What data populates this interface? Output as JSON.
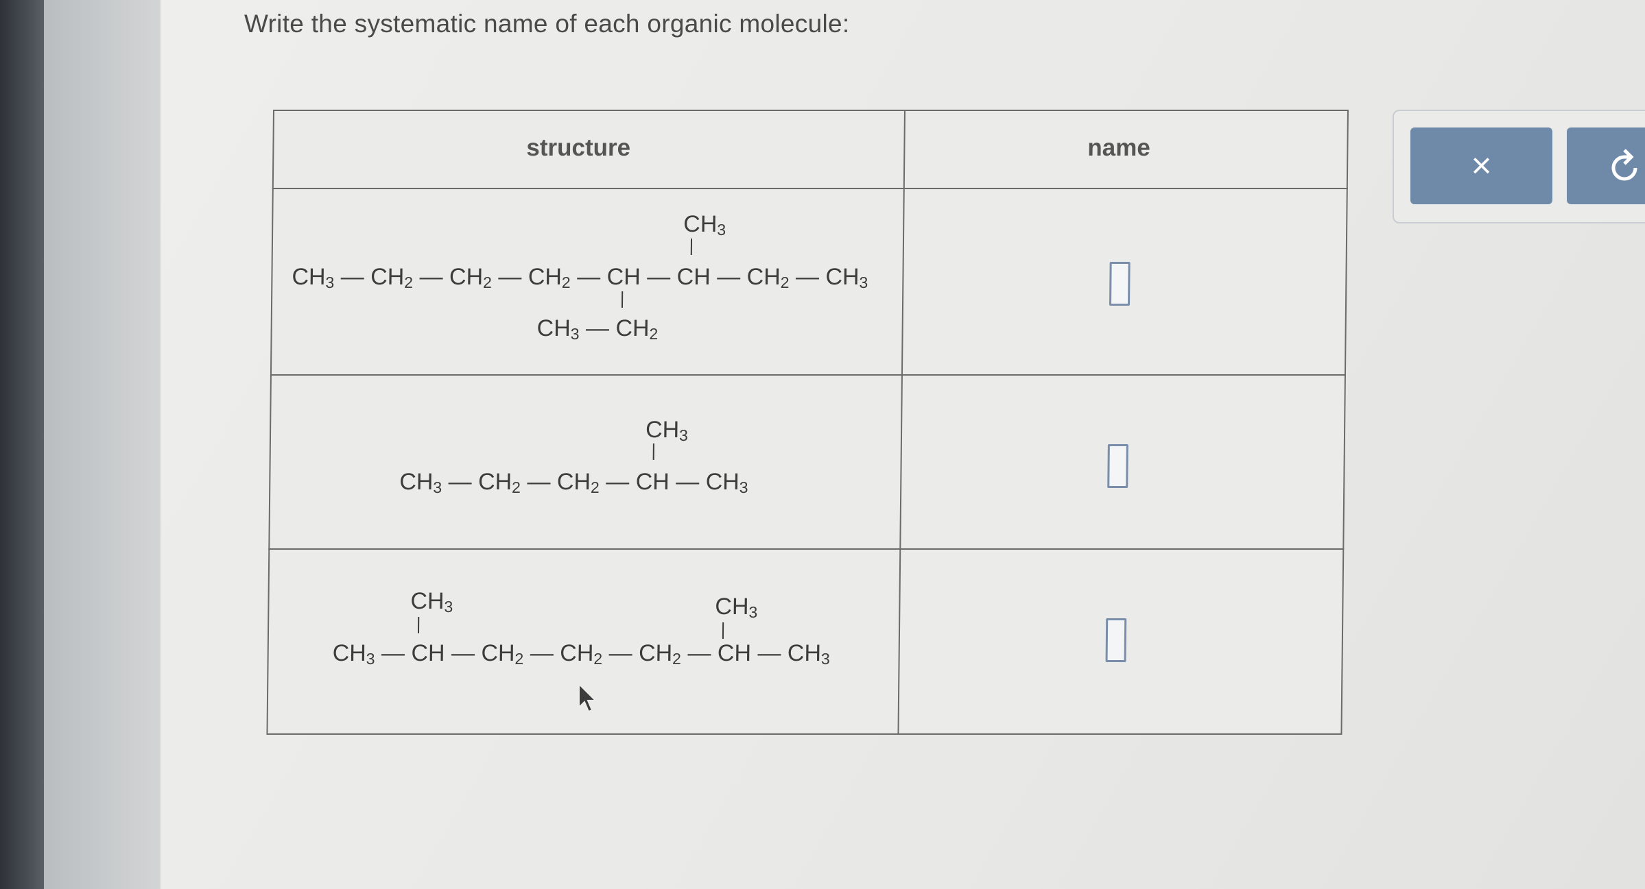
{
  "prompt": "Write the systematic name of each organic molecule:",
  "table": {
    "headers": {
      "structure": "structure",
      "name": "name"
    },
    "rows": [
      {
        "top": "CH3",
        "main": "CH3—CH2—CH2—CH2—CH—CH—CH2—CH3",
        "bottom": "CH3—CH2",
        "answer": ""
      },
      {
        "top": "CH3",
        "main": "CH3—CH2—CH2—CH—CH3",
        "answer": ""
      },
      {
        "top_left": "CH3",
        "top_right": "CH3",
        "main": "CH3—CH—CH2—CH2—CH2—CH—CH3",
        "answer": ""
      }
    ]
  },
  "buttons": {
    "clear_icon": "x-icon",
    "clear_label": "×",
    "undo_icon": "undo-icon"
  },
  "colors": {
    "button": "#6e8aa8",
    "answer_border": "#7a8eab"
  }
}
